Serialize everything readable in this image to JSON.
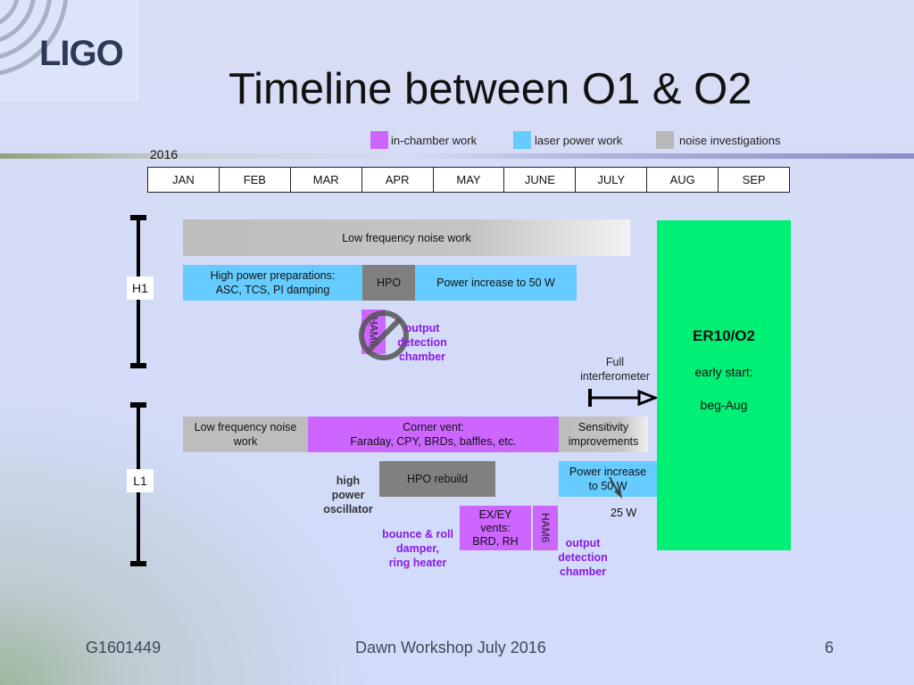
{
  "logo": {
    "text": "LIGO"
  },
  "title": "Timeline between O1 & O2",
  "year": "2016",
  "legend": [
    {
      "label": "in-chamber work",
      "color": "#cc66ff"
    },
    {
      "label": "laser power work",
      "color": "#66ccff"
    },
    {
      "label": "noise investigations",
      "color": "#b8b8b8"
    }
  ],
  "months": [
    "JAN",
    "FEB",
    "MAR",
    "APR",
    "MAY",
    "JUNE",
    "JULY",
    "AUG",
    "SEP"
  ],
  "sites": {
    "h1": "H1",
    "l1": "L1"
  },
  "h1": {
    "lf_noise": "Low frequency noise work",
    "hp_prep_line1": "High power preparations:",
    "hp_prep_line2": "ASC, TCS, PI damping",
    "hpo": "HPO",
    "power_increase": "Power increase to 50 W",
    "ham6": "HAM6",
    "odc_note": [
      "output",
      "detection",
      "chamber"
    ],
    "ham6_status": "cancelled"
  },
  "full_ifo": {
    "line1": "Full",
    "line2": "interferometer"
  },
  "er10": {
    "title": "ER10/O2",
    "line1": "early start:",
    "line2": "beg-Aug",
    "color": "#00f076"
  },
  "l1": {
    "lf_noise_line1": "Low frequency noise",
    "lf_noise_line2": "work",
    "corner_vent_line1": "Corner vent:",
    "corner_vent_line2": "Faraday, CPY, BRDs, baffles, etc.",
    "sensitivity_line1": "Sensitivity",
    "sensitivity_line2": "improvements",
    "hpo_rebuild": "HPO rebuild",
    "hpo_note": [
      "high",
      "power",
      "oscillator"
    ],
    "power_increase_line1": "Power increase",
    "power_increase_line2": "to 50 W",
    "power_25": "25 W",
    "exey_line1": "EX/EY",
    "exey_line2": "vents:",
    "exey_line3": "BRD, RH",
    "ham6": "HAM6",
    "bounce_note": [
      "bounce & roll",
      "damper,",
      "ring heater"
    ],
    "odc_note": [
      "output",
      "detection",
      "chamber"
    ]
  },
  "footer": {
    "left": "G1601449",
    "center": "Dawn Workshop July 2016",
    "right": "6"
  }
}
